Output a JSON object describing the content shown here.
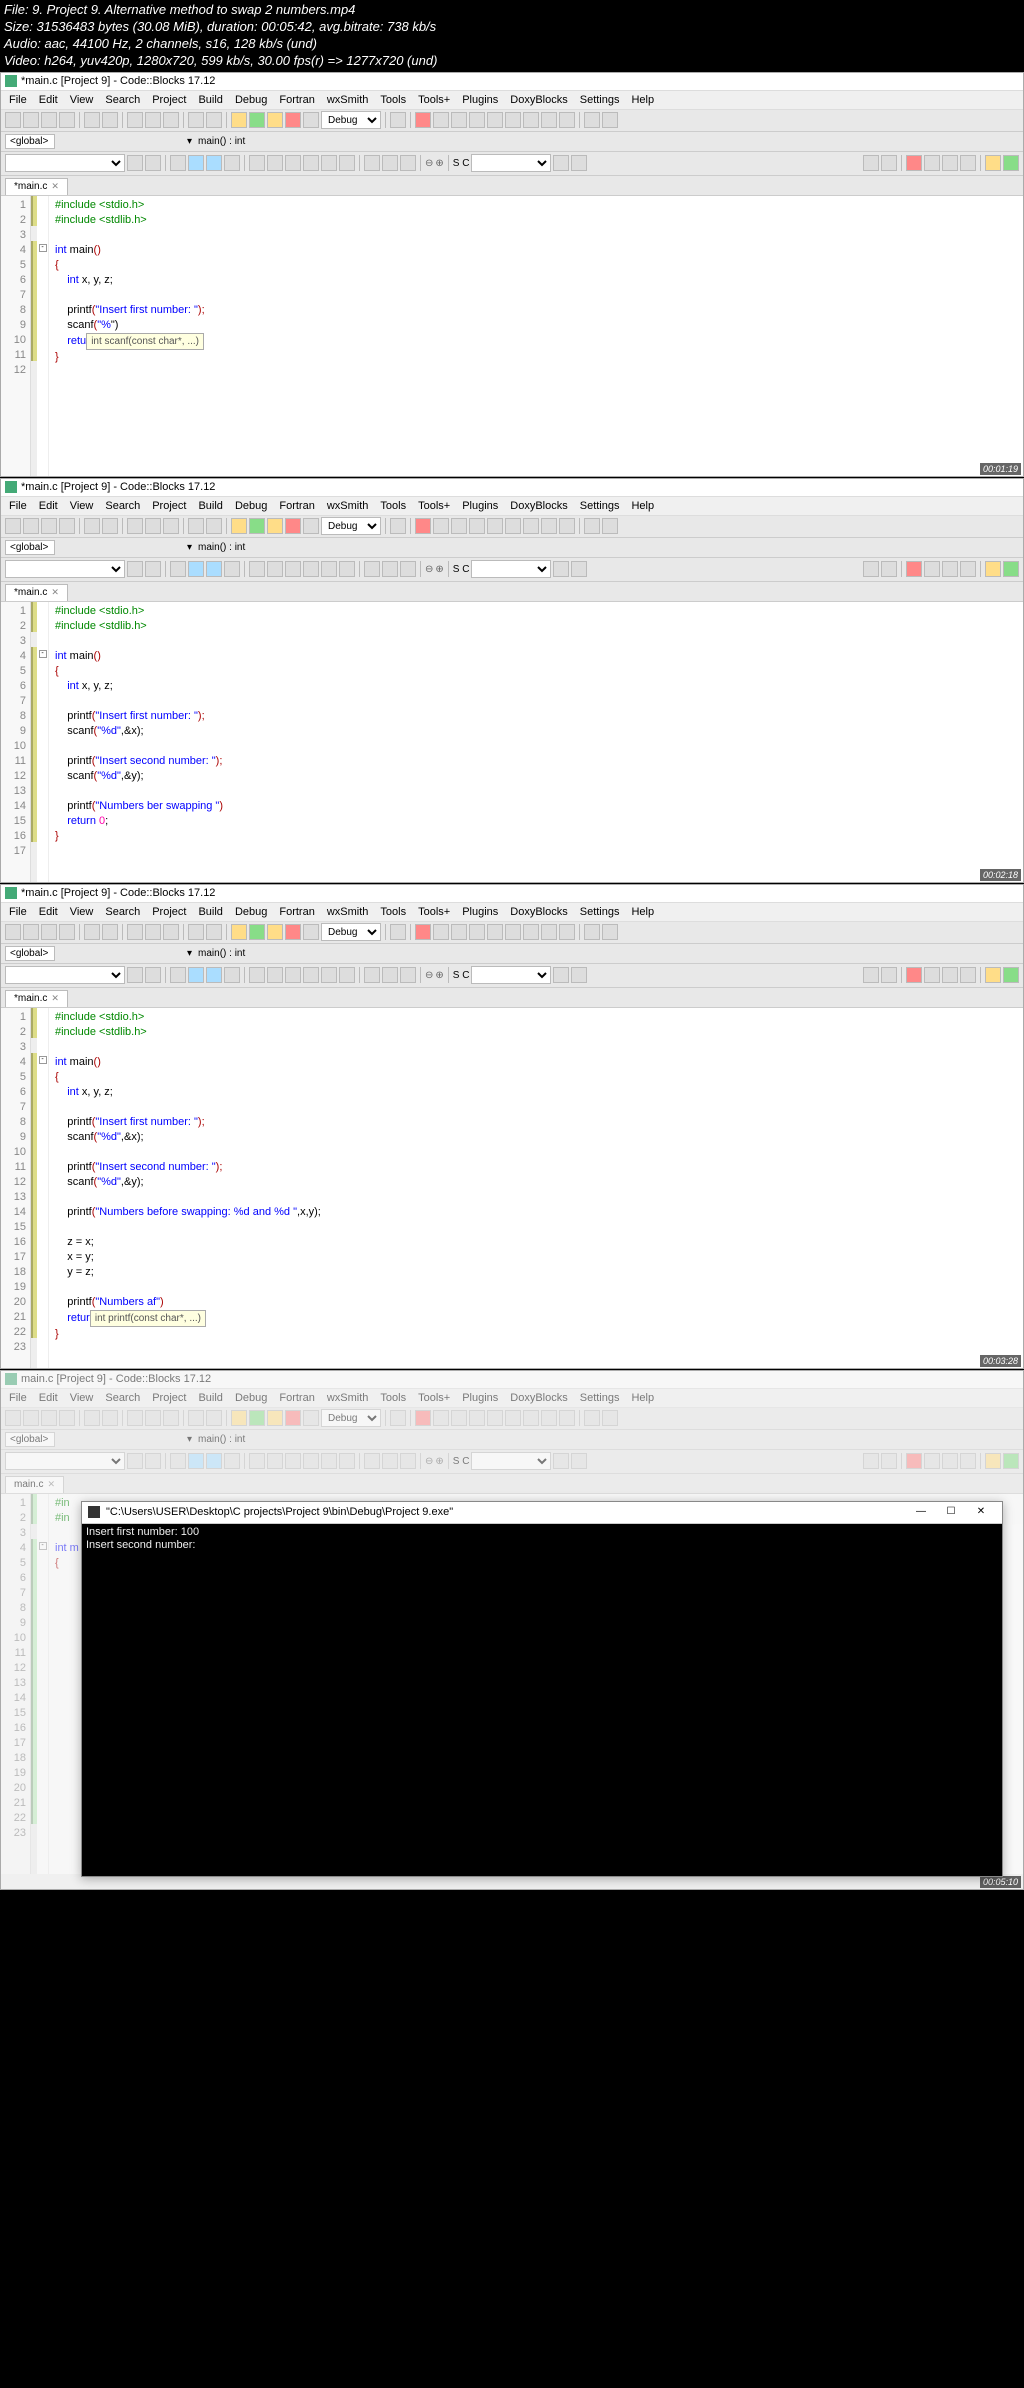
{
  "header": {
    "file": "File: 9. Project 9. Alternative method to swap 2 numbers.mp4",
    "size": "Size: 31536483 bytes (30.08 MiB), duration: 00:05:42, avg.bitrate: 738 kb/s",
    "audio": "Audio: aac, 44100 Hz, 2 channels, s16, 128 kb/s (und)",
    "video": "Video: h264, yuv420p, 1280x720, 599 kb/s, 30.00 fps(r) => 1277x720 (und)"
  },
  "menus": [
    "File",
    "Edit",
    "View",
    "Search",
    "Project",
    "Build",
    "Debug",
    "Fortran",
    "wxSmith",
    "Tools",
    "Tools+",
    "Plugins",
    "DoxyBlocks",
    "Settings",
    "Help"
  ],
  "scope_global": "<global>",
  "scope_fn": "main() : int",
  "build_target": "Debug",
  "tab_name": "*main.c",
  "tab_name_clean": "main.c",
  "sc_label": "S  C",
  "ide1": {
    "title": "*main.c [Project 9] - Code::Blocks 17.12",
    "timestamp": "00:01:19",
    "lines": [
      "1",
      "2",
      "3",
      "4",
      "5",
      "6",
      "7",
      "8",
      "9",
      "10",
      "11",
      "12"
    ],
    "code": {
      "l1": "#include <stdio.h>",
      "l2": "#include <stdlib.h>",
      "l4a": "int",
      "l4b": " main",
      "l4c": "()",
      "l5": "{",
      "l6a": "    int",
      "l6b": " x, y, z;",
      "l8a": "    printf",
      "l8b": "(",
      "l8c": "\"Insert first number: \"",
      "l8d": ");",
      "l9a": "    scanf",
      "l9b": "(",
      "l9c": "\"%",
      "l9d": "\")",
      "l10a": "    retu",
      "hint": "int scanf(const char*, ...)",
      "l11": "}"
    }
  },
  "ide2": {
    "title": "*main.c [Project 9] - Code::Blocks 17.12",
    "timestamp": "00:02:18",
    "lines": [
      "1",
      "2",
      "3",
      "4",
      "5",
      "6",
      "7",
      "8",
      "9",
      "10",
      "11",
      "12",
      "13",
      "14",
      "15",
      "16",
      "17"
    ],
    "code": {
      "l1": "#include <stdio.h>",
      "l2": "#include <stdlib.h>",
      "l4a": "int",
      "l4b": " main",
      "l4c": "()",
      "l5": "{",
      "l6a": "    int",
      "l6b": " x, y, z;",
      "l8a": "    printf",
      "l8b": "(",
      "l8c": "\"Insert first number: \"",
      "l8d": ");",
      "l9a": "    scanf",
      "l9b": "(",
      "l9c": "\"%d\"",
      "l9d": ",&x);",
      "l11a": "    printf",
      "l11b": "(",
      "l11c": "\"Insert second number: \"",
      "l11d": ");",
      "l12a": "    scanf",
      "l12b": "(",
      "l12c": "\"%d\"",
      "l12d": ",&y);",
      "l14a": "    printf",
      "l14b": "(",
      "l14c": "\"Numbers ber swapping \"",
      "l14d": ")",
      "l15a": "    return ",
      "l15b": "0",
      "l15c": ";",
      "l16": "}"
    }
  },
  "ide3": {
    "title": "*main.c [Project 9] - Code::Blocks 17.12",
    "timestamp": "00:03:28",
    "lines": [
      "1",
      "2",
      "3",
      "4",
      "5",
      "6",
      "7",
      "8",
      "9",
      "10",
      "11",
      "12",
      "13",
      "14",
      "15",
      "16",
      "17",
      "18",
      "19",
      "20",
      "21",
      "22",
      "23"
    ],
    "code": {
      "l1": "#include <stdio.h>",
      "l2": "#include <stdlib.h>",
      "l4a": "int",
      "l4b": " main",
      "l4c": "()",
      "l5": "{",
      "l6a": "    int",
      "l6b": " x, y, z;",
      "l8a": "    printf",
      "l8b": "(",
      "l8c": "\"Insert first number: \"",
      "l8d": ");",
      "l9a": "    scanf",
      "l9b": "(",
      "l9c": "\"%d\"",
      "l9d": ",&x);",
      "l11a": "    printf",
      "l11b": "(",
      "l11c": "\"Insert second number: \"",
      "l11d": ");",
      "l12a": "    scanf",
      "l12b": "(",
      "l12c": "\"%d\"",
      "l12d": ",&y);",
      "l14a": "    printf",
      "l14b": "(",
      "l14c": "\"Numbers before swapping: %d and %d \"",
      "l14d": ",x,y);",
      "l16": "    z = x;",
      "l17": "    x = y;",
      "l18": "    y = z;",
      "l20a": "    printf",
      "l20b": "(",
      "l20c": "\"Numbers af\"",
      "l20d": ")",
      "l21a": "    retur",
      "hint": "int printf(const char*, ...)",
      "l22": "}"
    }
  },
  "ide4": {
    "title": "main.c [Project 9] - Code::Blocks 17.12",
    "timestamp": "00:05:10",
    "lines": [
      "1",
      "2",
      "3",
      "4",
      "5",
      "6",
      "7",
      "8",
      "9",
      "10",
      "11",
      "12",
      "13",
      "14",
      "15",
      "16",
      "17",
      "18",
      "19",
      "20",
      "21",
      "22",
      "23"
    ],
    "console_title": "\"C:\\Users\\USER\\Desktop\\C projects\\Project 9\\bin\\Debug\\Project 9.exe\"",
    "console_line1": "Insert first number: 100",
    "console_line2": "Insert second number:",
    "code": {
      "l1": "#in",
      "l2": "#in",
      "l4": "int m",
      "l5": "{"
    }
  }
}
